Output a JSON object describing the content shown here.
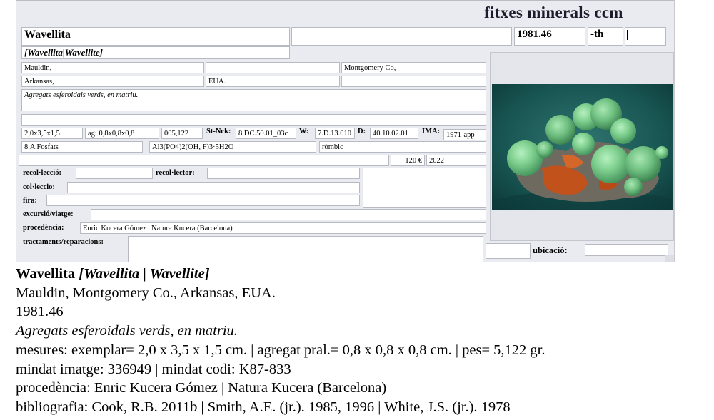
{
  "form": {
    "app_title": "fitxes minerals ccm",
    "name": "Wavellita",
    "field_blank_top": "",
    "catalog_number": "1981.46",
    "suffix": "-th",
    "suffix_extra": "",
    "synonyms": "[Wavellita|Wavellite]",
    "locality": "Mauldin,",
    "locality_2": "",
    "county": "Montgomery Co,",
    "state": "Arkansas,",
    "country": "EUA.",
    "country_extra": "",
    "description": "Agregats esferoidals verds, en matriu.",
    "notes": "",
    "size": "2,0x3,5x1,5",
    "aggregate": "ag: 0,8x0,8x0,8",
    "weight": "005,122",
    "strunz_label": "St-Nck:",
    "strunz_value": "8.DC.50.01_03c",
    "w_label": "W:",
    "w_value": "7.D.13.010",
    "d_label": "D:",
    "d_value": "40.10.02.01",
    "ima_label": "IMA:",
    "ima_value": "1971-app",
    "class": "8.A Fosfats",
    "formula": "Al3(PO4)2(OH, F)3·5H2O",
    "crystal_system": "ròmbic",
    "blank_row": "",
    "price": "120 €",
    "year": "2022",
    "collected_label": "recol·lecció:",
    "collected_value": "",
    "collector_label": "recol·lector:",
    "collector_value": "",
    "collection_label": "col·leccio:",
    "collection_value": "",
    "fair_label": "fira:",
    "fair_value": "",
    "trip_label": "excursió/viatge:",
    "trip_value": "",
    "provenance_label": "procedència:",
    "provenance_value": "Enric Kucera Gómez | Natura Kucera (Barcelona)",
    "treatments_label": "tractaments/reparacions:",
    "treatments_value": "",
    "location_label": "ubicació:",
    "location_value": "",
    "location_prefix": ""
  },
  "caption": {
    "name": "Wavellita",
    "synonyms": "[Wavellita | Wavellite]",
    "locality": "Mauldin, Montgomery Co., Arkansas, EUA.",
    "catalog": "1981.46",
    "description": "Agregats esferoidals verds, en matriu.",
    "measures": "mesures: exemplar= 2,0 x 3,5 x 1,5 cm. | agregat pral.= 0,8 x 0,8 x 0,8 cm. | pes= 5,122 gr.",
    "mindat": "mindat imatge: 336949 | mindat codi: K87-833",
    "provenance": "procedència: Enric Kucera Gómez | Natura Kucera (Barcelona)",
    "bibliography": "bibliografia: Cook, R.B. 2011b | Smith, A.E. (jr.). 1985, 1996 | White, J.S. (jr.). 1978"
  },
  "colors": {
    "form_background": "#e9ebf0",
    "photo_background": "#14504f",
    "mineral_green": "#7ecb8f",
    "matrix_orange": "#c2521c"
  }
}
